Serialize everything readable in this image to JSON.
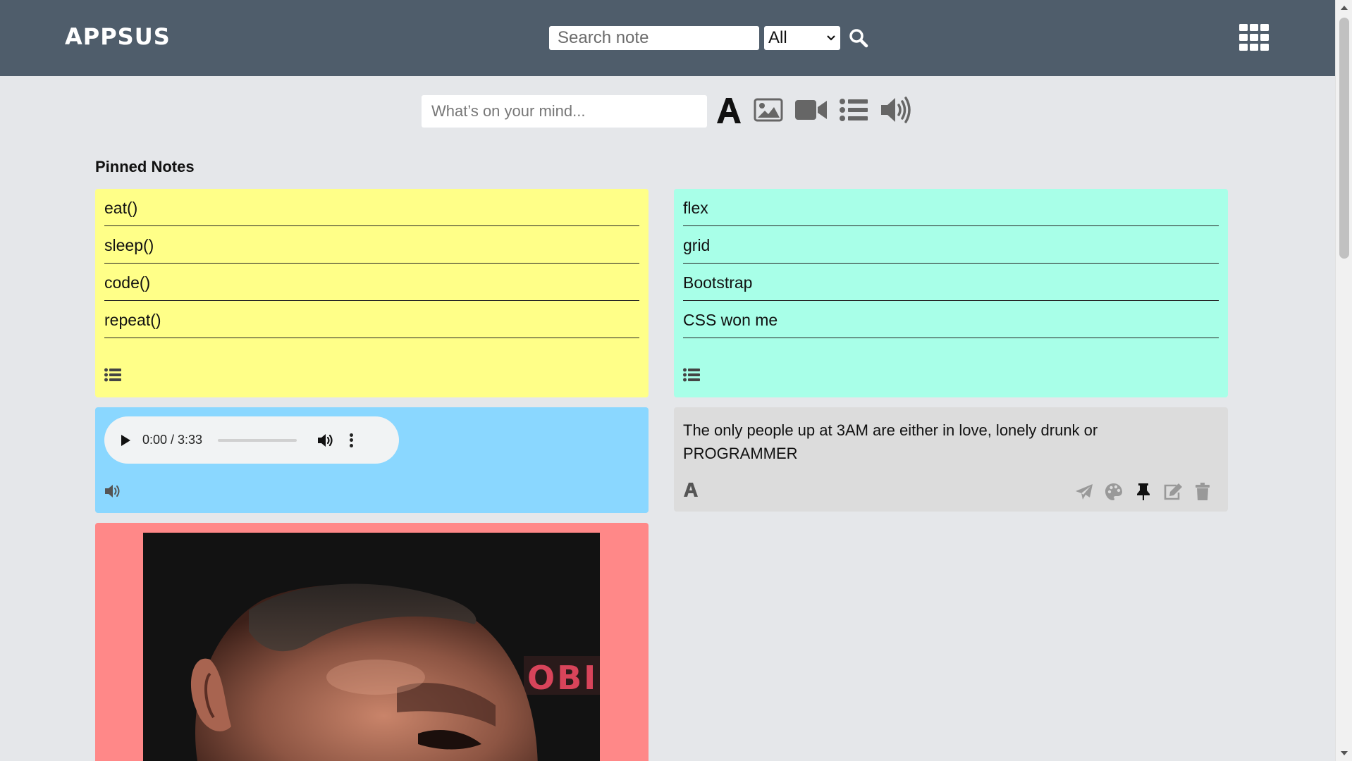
{
  "app": {
    "logo": "APPSUS"
  },
  "header": {
    "search_placeholder": "Search note",
    "filter_value": "All"
  },
  "composer": {
    "placeholder": "What’s on your mind..."
  },
  "pinned": {
    "title": "Pinned Notes"
  },
  "colors": {
    "header_bg": "#4f5d6b",
    "page_bg": "#e5e7ea",
    "note_yellow": "#ffff88",
    "note_teal": "#a8ffe8",
    "note_blue": "#8ad7ff",
    "note_gray": "#dcdcdc",
    "note_red": "#ff8888"
  },
  "notes": {
    "todo1": {
      "items": [
        "eat()",
        "sleep()",
        "code()",
        "repeat()"
      ],
      "icon": "list-icon"
    },
    "todo2": {
      "items": [
        "flex",
        "grid",
        "Bootstrap",
        "CSS won me"
      ],
      "icon": "list-icon"
    },
    "audio": {
      "time": "0:00 / 3:33",
      "progress": 0.0,
      "icon": "volume-icon"
    },
    "text": {
      "content": "The only people up at 3AM are either in love, lonely drunk or PROGRAMMER",
      "icon": "text-icon"
    },
    "image": {
      "icon": "image-icon"
    }
  }
}
